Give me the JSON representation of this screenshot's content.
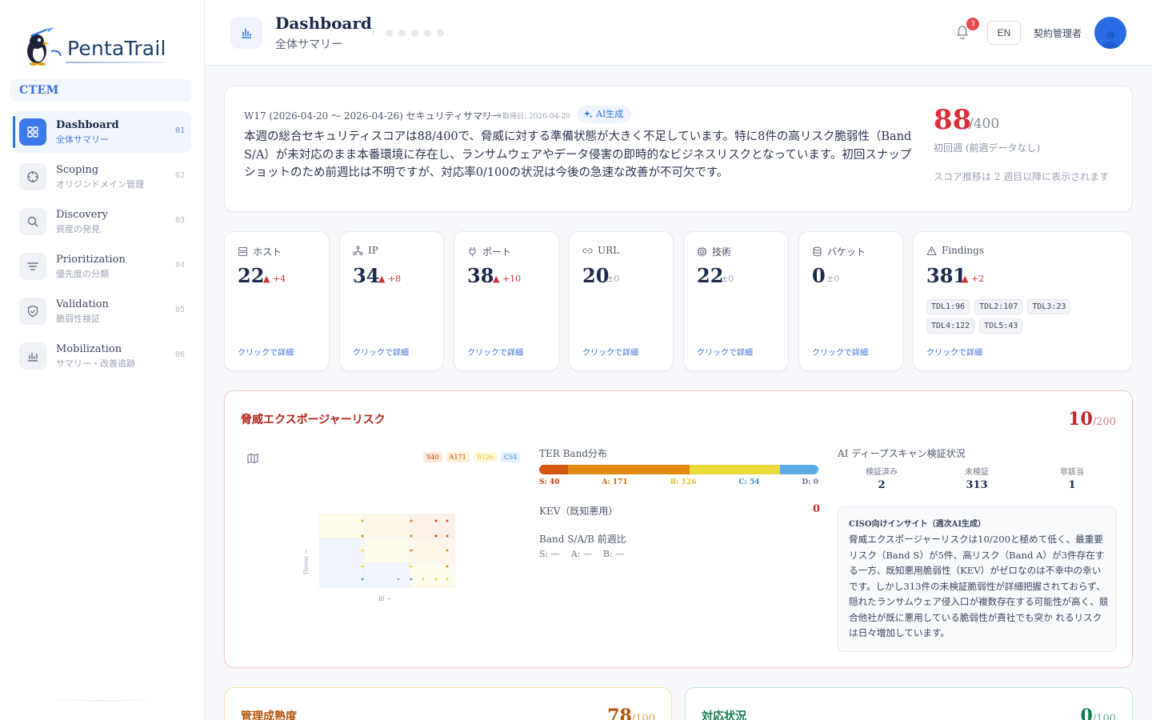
{
  "brand": {
    "name": "PentaTrail",
    "section": "CTEM"
  },
  "nav": [
    {
      "title": "Dashboard",
      "sub": "全体サマリー",
      "num": "01",
      "icon": "dashboard-icon"
    },
    {
      "title": "Scoping",
      "sub": "オリジンドメイン管理",
      "num": "02",
      "icon": "crosshair-icon"
    },
    {
      "title": "Discovery",
      "sub": "資産の発見",
      "num": "03",
      "icon": "search-icon"
    },
    {
      "title": "Prioritization",
      "sub": "優先度の分類",
      "num": "04",
      "icon": "filter-icon"
    },
    {
      "title": "Validation",
      "sub": "脆弱性検証",
      "num": "05",
      "icon": "shield-check-icon"
    },
    {
      "title": "Mobilization",
      "sub": "サマリー・改善追跡",
      "num": "06",
      "icon": "bar-chart-icon"
    }
  ],
  "header": {
    "title": "Dashboard",
    "subtitle": "全体サマリー",
    "notification_count": "3",
    "lang": "EN",
    "user": "契約管理者"
  },
  "summary": {
    "heading": "W17 (2026-04-20 〜 2026-04-26) セキュリティサマリー",
    "date": "データ取得日: 2026-04-20",
    "ai_badge": "AI生成",
    "text": "本週の総合セキュリティスコアは88/400で、脅威に対する準備状態が大きく不足しています。特に8件の高リスク脆弱性（Band S/A）が未対応のまま本番環境に存在し、ランサムウェアやデータ侵害の即時的なビジネスリスクとなっています。初回スナップショットのため前週比は不明ですが、対応率0/100の状況は今後の急速な改善が不可欠です。",
    "score": "88",
    "score_max": "/400",
    "note1": "初回週 (前週データなし)",
    "note2": "スコア推移は 2 週目以降に表示されます"
  },
  "metrics": [
    {
      "label": "ホスト",
      "value": "22",
      "delta": "▲ +4",
      "trend": "up",
      "icon": "server-icon"
    },
    {
      "label": "IP",
      "value": "34",
      "delta": "▲ +8",
      "trend": "up",
      "icon": "network-icon"
    },
    {
      "label": "ポート",
      "value": "38",
      "delta": "▲ +10",
      "trend": "up",
      "icon": "plug-icon"
    },
    {
      "label": "URL",
      "value": "20",
      "delta": "±0",
      "trend": "zero",
      "icon": "link-icon"
    },
    {
      "label": "技術",
      "value": "22",
      "delta": "±0",
      "trend": "zero",
      "icon": "cpu-icon"
    },
    {
      "label": "バケット",
      "value": "0",
      "delta": "±0",
      "trend": "zero",
      "icon": "database-icon"
    },
    {
      "label": "Findings",
      "value": "381",
      "delta": "▲ +2",
      "trend": "up",
      "icon": "alert-triangle-icon"
    }
  ],
  "metric_link": "クリックで詳細",
  "tdl": [
    "TDL1:96",
    "TDL2:107",
    "TDL3:23",
    "TDL4:122",
    "TDL5:43"
  ],
  "risk": {
    "title": "脅威エクスポージャーリスク",
    "score": "10",
    "score_max": "/200",
    "legend": [
      {
        "label": "S40",
        "color": "#c2410c",
        "bg": "#fde9dc"
      },
      {
        "label": "A171",
        "color": "#b45309",
        "bg": "#fdf0d5"
      },
      {
        "label": "B126",
        "color": "#e3c21a",
        "bg": "#fdf9dc"
      },
      {
        "label": "C54",
        "color": "#3b8fd9",
        "bg": "#e5f1fb"
      }
    ],
    "heat_y": "Threat →",
    "heat_x": "BI →",
    "ter_title": "TER Band分布",
    "ter": [
      {
        "label": "S: 40",
        "value": 40,
        "color": "#d4560f",
        "text": "#c2410c"
      },
      {
        "label": "A: 171",
        "value": 171,
        "color": "#e38a0c",
        "text": "#c2690a"
      },
      {
        "label": "B: 126",
        "value": 126,
        "color": "#ecd93a",
        "text": "#d8c22a"
      },
      {
        "label": "C: 54",
        "value": 54,
        "color": "#5aabe6",
        "text": "#3b8fd9"
      },
      {
        "label": "D: 0",
        "value": 0,
        "color": "#b9c0cc",
        "text": "#6b7488"
      }
    ],
    "kev_label": "KEV（既知悪用）",
    "kev_value": "0",
    "band_title": "Band S/A/B 前週比",
    "band_vals": [
      "S: —",
      "A: —",
      "B: —"
    ],
    "deep_title": "AI ディープスキャン検証状況",
    "deep": [
      {
        "label": "検証済み",
        "value": "2"
      },
      {
        "label": "未検証",
        "value": "313"
      },
      {
        "label": "非該当",
        "value": "1"
      }
    ],
    "insight_title": "CISO向けインサイト（週次AI生成）",
    "insight_text": "脅威エクスポージャーリスクは10/200と極めて低く、最重要リスク（Band S）が5件、高リスク（Band A）が3件存在する一方、既知悪用脆弱性（KEV）がゼロなのは不幸中の幸いです。しかし313件の未検証脆弱性が詳細把握されておらず、隠れたランサムウェア侵入口が複数存在する可能性が高く、競合他社が既に悪用している脆弱性が貴社でも突か れるリスクは日々増加しています。"
  },
  "bottom": [
    {
      "title": "管理成熟度",
      "score": "78",
      "max": "/100",
      "color": "#b45309",
      "border": "#f6dfa8",
      "maxColor": "#d9a24a"
    },
    {
      "title": "対応状況",
      "score": "0",
      "max": "/100",
      "color": "#0f7a4a",
      "border": "#bfe8d3",
      "maxColor": "#4fb887"
    }
  ]
}
